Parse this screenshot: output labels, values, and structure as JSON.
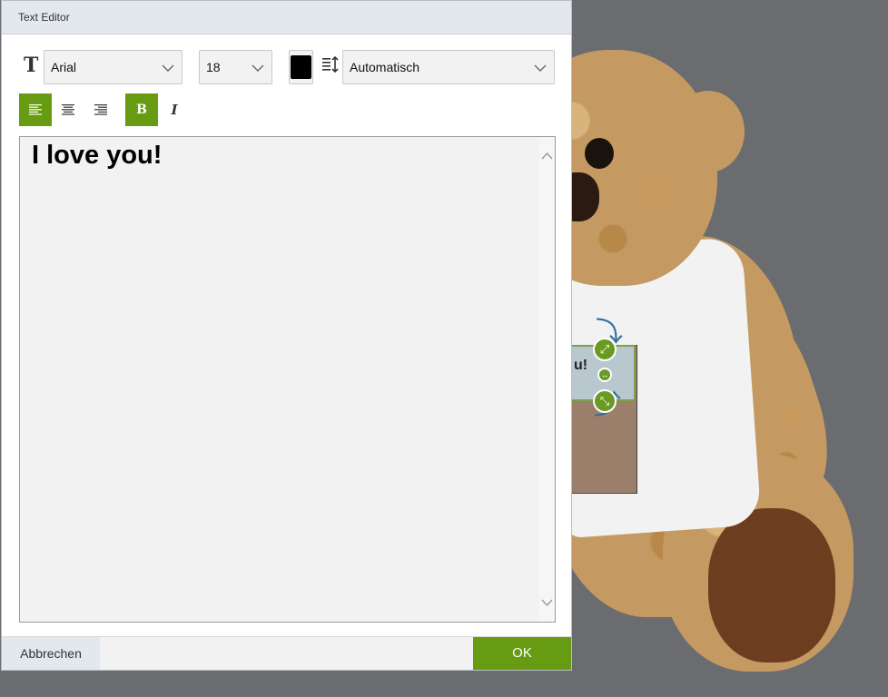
{
  "dialog": {
    "title": "Text Editor"
  },
  "toolbar": {
    "font_family": "Arial",
    "font_size": "18",
    "text_color": "#000000",
    "line_height": "Automatisch",
    "align_left_active": true,
    "bold_active": true,
    "bold_label": "B",
    "italic_label": "I"
  },
  "editor": {
    "text": "I love you!"
  },
  "footer": {
    "cancel_label": "Abbrechen",
    "ok_label": "OK"
  },
  "canvas": {
    "print_text_fragment": "u!"
  },
  "colors": {
    "accent": "#679b12",
    "backdrop": "#6b6c70",
    "titlebar": "#e3e8ef"
  }
}
